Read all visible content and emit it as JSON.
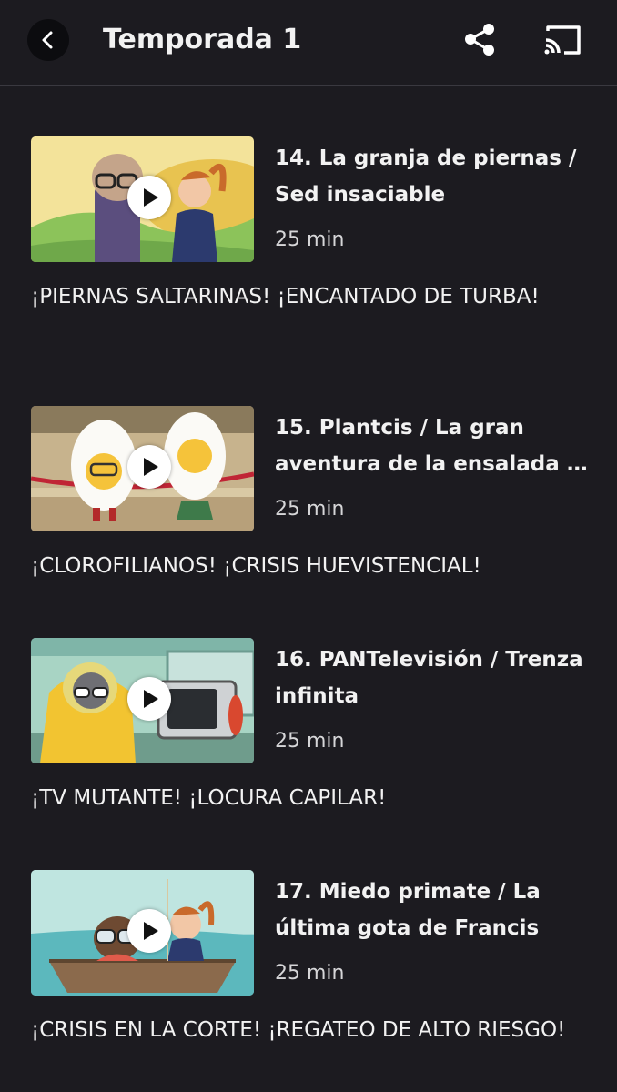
{
  "header": {
    "title": "Temporada 1",
    "back_icon": "chevron-left-icon",
    "share_icon": "share-icon",
    "cast_icon": "cast-icon"
  },
  "episodes": [
    {
      "title": "14. La granja de piernas / Sed insaciable",
      "duration": "25 min",
      "description": "¡PIERNAS SALTARINAS! ¡ENCANTADO DE TURBA!"
    },
    {
      "title": "15. Plantcis / La gran aventura de la ensalada d...",
      "title_line1": "15. Plantcis / La gran",
      "title_line2": "aventura de la ensalada d...",
      "duration": "25 min",
      "description": "¡CLOROFILIANOS! ¡CRISIS HUEVISTENCIAL!"
    },
    {
      "title": "16. PANTelevisión / Trenza infinita",
      "duration": "25 min",
      "description": "¡TV MUTANTE! ¡LOCURA CAPILAR!"
    },
    {
      "title": "17. Miedo primate / La última gota de Francis",
      "duration": "25 min",
      "description": "¡CRISIS EN LA CORTE! ¡REGATEO DE ALTO RIESGO!"
    }
  ],
  "colors": {
    "background": "#1c1b20",
    "text": "#f2f2f2",
    "secondary_text": "#d6d6d8"
  }
}
